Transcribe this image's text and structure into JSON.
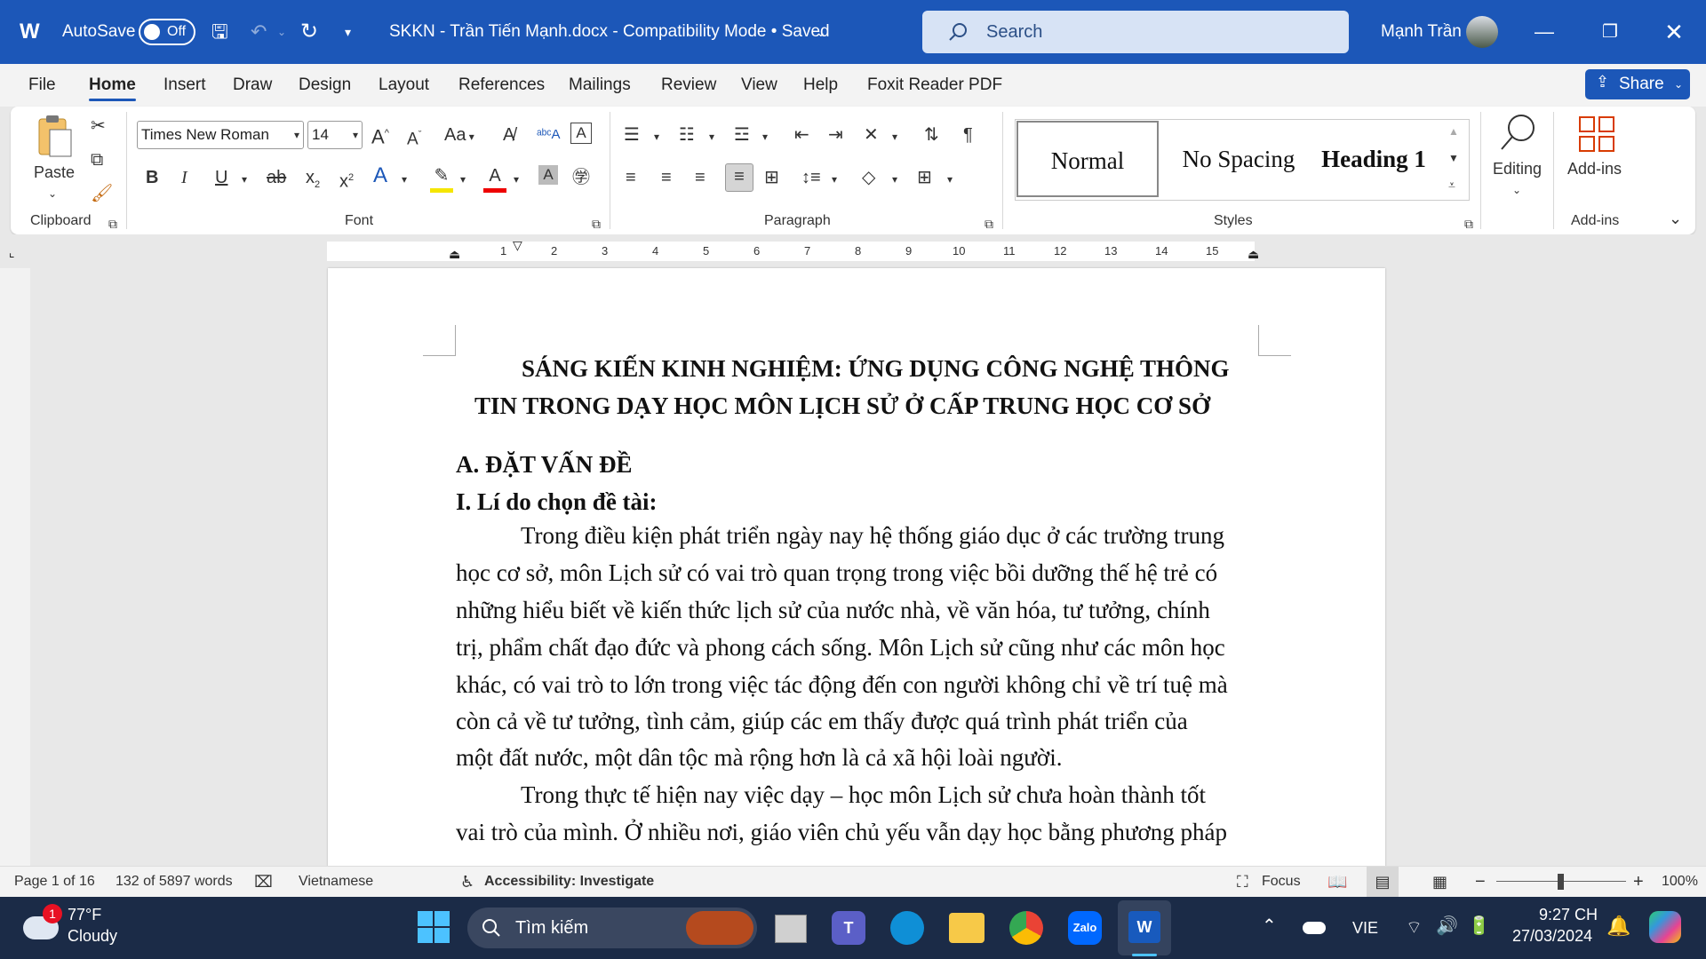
{
  "titlebar": {
    "autosave_label": "AutoSave",
    "autosave_state": "Off",
    "document_title": "SKKN - Trần Tiến Mạnh.docx  -  Compatibility Mode • Saved",
    "search_placeholder": "Search",
    "user_name": "Mạnh Trần",
    "accent_color": "#1c57b8"
  },
  "menu": {
    "items": [
      "File",
      "Home",
      "Insert",
      "Draw",
      "Design",
      "Layout",
      "References",
      "Mailings",
      "Review",
      "View",
      "Help",
      "Foxit Reader PDF"
    ],
    "active": "Home",
    "share_label": "Share"
  },
  "ribbon": {
    "clipboard": {
      "paste_label": "Paste",
      "group_label": "Clipboard"
    },
    "font": {
      "font_name": "Times New Roman",
      "font_size": "14",
      "group_label": "Font",
      "case_label": "Aa"
    },
    "paragraph": {
      "group_label": "Paragraph"
    },
    "styles": {
      "items": [
        "Normal",
        "No Spacing",
        "Heading 1"
      ],
      "group_label": "Styles"
    },
    "editing": {
      "label": "Editing"
    },
    "addins": {
      "label": "Add-ins",
      "group_label": "Add-ins"
    }
  },
  "ruler": {
    "numbers": [
      "1",
      "2",
      "3",
      "4",
      "5",
      "6",
      "7",
      "8",
      "9",
      "10",
      "11",
      "12",
      "13",
      "14",
      "15"
    ]
  },
  "document": {
    "title_line1": "SÁNG KIẾN KINH NGHIỆM: ỨNG DỤNG CÔNG NGHỆ THÔNG",
    "title_line2": "TIN TRONG DẠY HỌC MÔN LỊCH SỬ Ở CẤP TRUNG HỌC CƠ SỞ",
    "section_a": "A. ĐẶT VẤN ĐỀ",
    "section_i": "I. Lí do chọn đề tài:",
    "para1": [
      "Trong điều kiện phát triển ngày nay hệ thống giáo dục ở các trường trung",
      "học cơ sở, môn Lịch sử có vai trò quan trọng trong việc bồi dưỡng thế hệ trẻ có",
      "những hiểu biết về kiến thức lịch sử của nước nhà, về văn hóa, tư tưởng, chính",
      "trị, phẩm chất đạo đức và phong cách sống. Môn Lịch sử cũng như các môn học",
      "khác, có vai trò to lớn trong việc tác động đến con người không chỉ về trí tuệ mà",
      "còn cả về tư tưởng, tình cảm, giúp các em thấy được quá trình phát triển của",
      "một đất nước, một dân tộc mà rộng hơn là cả xã hội loài người."
    ],
    "para2": [
      "Trong thực tế hiện nay việc dạy – học môn Lịch sử chưa hoàn thành tốt",
      "vai trò của mình. Ở nhiều nơi, giáo viên chủ yếu vẫn dạy học bằng phương pháp"
    ]
  },
  "statusbar": {
    "page": "Page 1 of 16",
    "words": "132 of 5897 words",
    "language": "Vietnamese",
    "accessibility": "Accessibility: Investigate",
    "focus": "Focus",
    "zoom": "100%",
    "zoom_minus": "−",
    "zoom_plus": "+"
  },
  "taskbar": {
    "weather_temp": "77°F",
    "weather_desc": "Cloudy",
    "weather_badge": "1",
    "search_placeholder": "Tìm kiếm",
    "input_lang": "VIE",
    "time": "9:27 CH",
    "date": "27/03/2024"
  }
}
